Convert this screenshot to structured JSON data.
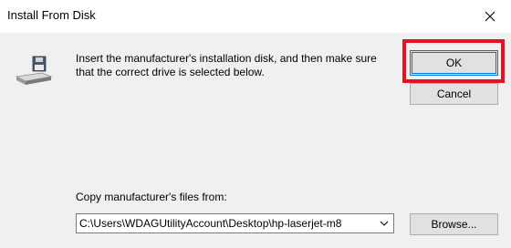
{
  "window": {
    "title": "Install From Disk",
    "close_icon": "close-icon"
  },
  "body": {
    "icon": "floppy-disk-drive-icon",
    "instruction": "Insert the manufacturer's installation disk, and then make sure that the correct drive is selected below."
  },
  "buttons": {
    "ok_label": "OK",
    "cancel_label": "Cancel",
    "browse_label": "Browse..."
  },
  "copy_from": {
    "label": "Copy manufacturer's files from:",
    "value": "C:\\Users\\WDAGUtilityAccount\\Desktop\\hp-laserjet-m8",
    "dropdown_icon": "chevron-down-icon"
  },
  "colors": {
    "highlight": "#e81123",
    "focus": "#0078d7",
    "background": "#f0f0f0"
  }
}
